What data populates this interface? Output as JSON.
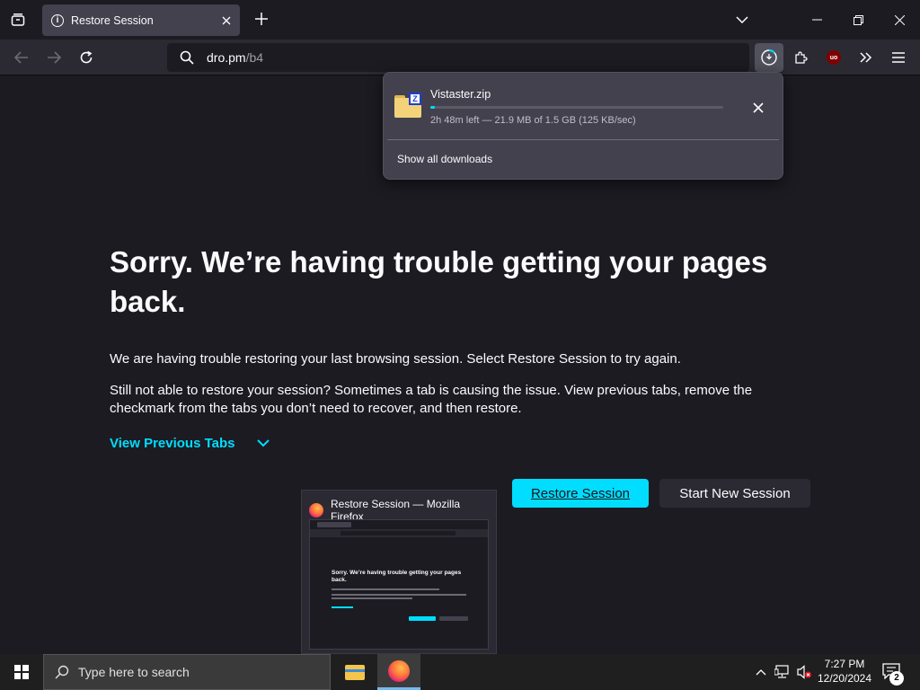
{
  "tab": {
    "title": "Restore Session"
  },
  "urlbar": {
    "host": "dro.pm",
    "path": "/b4"
  },
  "downloads": {
    "file_name": "Vistaster.zip",
    "status": "2h 48m left — 21.9 MB of 1.5 GB (125 KB/sec)",
    "progress_fraction": 0.015,
    "show_all_label": "Show all downloads"
  },
  "page": {
    "heading": "Sorry. We’re having trouble getting your pages back.",
    "paragraph1": "We are having trouble restoring your last browsing session. Select Restore Session to try again.",
    "paragraph2": "Still not able to restore your session? Sometimes a tab is causing the issue. View previous tabs, remove the checkmark from the tabs you don’t need to recover, and then restore.",
    "view_previous_tabs": "View Previous Tabs",
    "restore_button": "Restore Session",
    "new_session_button": "Start New Session"
  },
  "thumbnail": {
    "title": "Restore Session — Mozilla Firefox",
    "mini_heading": "Sorry. We’re having trouble getting your pages back."
  },
  "taskbar": {
    "search_placeholder": "Type here to search",
    "time": "7:27 PM",
    "date": "12/20/2024",
    "notification_count": "2"
  },
  "colors": {
    "accent": "#00ddff",
    "background": "#1c1b22",
    "toolbar": "#2b2a33"
  }
}
